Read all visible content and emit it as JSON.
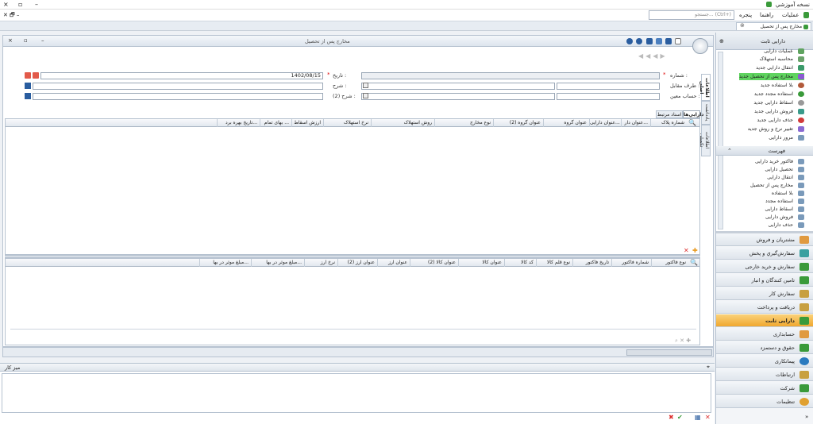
{
  "app": {
    "title": "نسخه آموزشي"
  },
  "menu": {
    "items": [
      "عمليات",
      "راهنما",
      "پنجره"
    ],
    "search_placeholder": "جستجو... (Ctrl+)"
  },
  "doc_tab": {
    "label": "مخارج پس از تحصيل"
  },
  "form": {
    "title": "مخارج پس از تحصيل",
    "number_label": "شماره :",
    "date_label": "تاريخ :",
    "date_value": "1402/08/15",
    "counterparty_label": "طرف مقابل :",
    "desc_label": "شرح :",
    "specific_account_label": "حساب معين :",
    "desc2_label": "شرح (2) :"
  },
  "side_tabs": [
    "اطلاعات اصلی",
    "يادداشت",
    "اطلاعات تکميلی"
  ],
  "grid_tabs": [
    "دارايي‌ها",
    "اسناد مرتبط"
  ],
  "upper_grid": {
    "columns": [
      "شماره پلاک",
      "عنوان دار...",
      "عنوان دارايی...",
      "عنوان گروه",
      "عنوان گروه (2)",
      "نوع مخارج",
      "روش استهلاک",
      "نرخ استهلاک",
      "ارزش اسقاط",
      "بهای تمام ...",
      "تاريخ بهره برد..."
    ]
  },
  "lower_grid": {
    "columns": [
      "نوع فاکتور",
      "شماره فاکتور",
      "تاريخ فاکتور",
      "نوع قلم کالا",
      "کد کالا",
      "عنوان کالا",
      "عنوان کالا (2)",
      "عنوان ارز",
      "عنوان ارز (2)",
      "نرخ ارز",
      "مبلغ موثر در بها...",
      "مبلغ موثر در بها..."
    ]
  },
  "desk": {
    "title": "ميز کار"
  },
  "nav": {
    "section_title": "دارايی ثابت",
    "operations": [
      "عمليات دارايی",
      "محاسبه استهلاک",
      "انتقال دارايی جديد",
      "مخارج پس از تحصيل جديد",
      "بلا استفاده جديد",
      "استفاده مجدد جديد",
      "اسقاط دارايی جديد",
      "فروش دارايی جديد",
      "حذف دارايی جديد",
      "تغيير نرخ و روش جديد",
      "مرور دارايی"
    ],
    "list_title": "فهرست",
    "lists": [
      "فاکتور خريد دارايی",
      "تحصيل دارايی",
      "انتقال دارايی",
      "مخارج پس از تحصيل",
      "بلا استفاده",
      "استفاده مجدد",
      "اسقاط دارايی",
      "فروش دارايی",
      "حذف دارايی"
    ],
    "modules": [
      "مشتريان و فروش",
      "سفارش‌گيري و پخش",
      "سفارش و خريد خارجی",
      "تامين کنندگان و انبار",
      "سفارش کار",
      "دريافت و پرداخت",
      "دارايی ثابت",
      "حسابداری",
      "حقوق و دستمزد",
      "پيمانکاری",
      "ارتباطات",
      "شرکت",
      "تنظيمات"
    ]
  },
  "colors": {
    "accent": "#f0a830",
    "highlight": "#5fd35f"
  }
}
